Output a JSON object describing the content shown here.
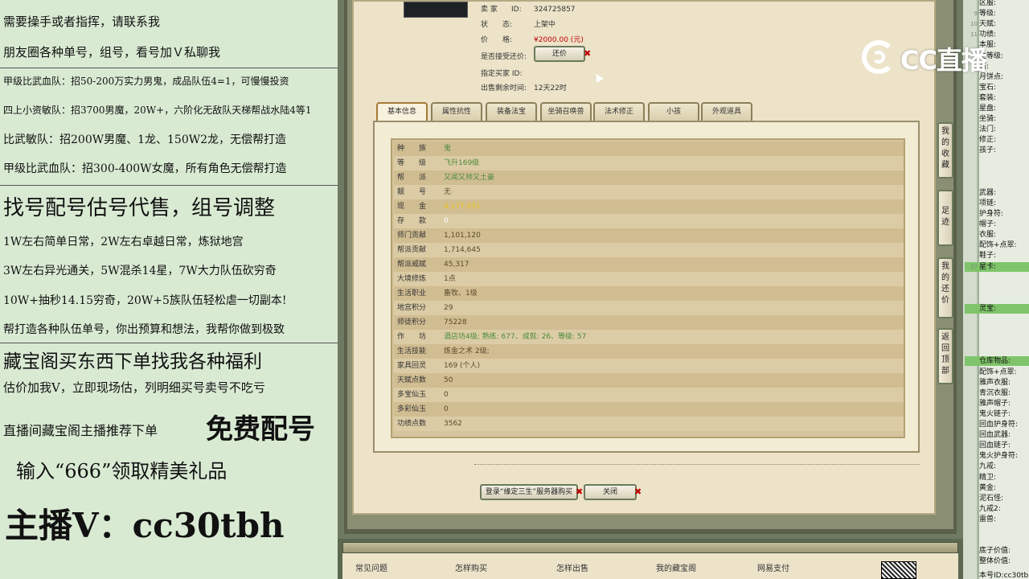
{
  "promo": {
    "lines": [
      "需要操手或者指挥，请联系我",
      "朋友圈各种单号，组号，看号加Ｖ私聊我",
      "甲级比武血队：招50-200万实力男鬼，成品队伍4=1，可慢慢投资",
      "四上小资敏队：招3700男魔，20W+，六阶化无敌队天梯帮战水陆4等1",
      "比武敏队：招200W男魔、1龙、150W2龙，无偿帮打造",
      "甲级比武血队：招300-400W女魔，所有角色无偿帮打造",
      "找号配号估号代售，组号调整",
      "1W左右简单日常，2W左右卓越日常，炼狱地宫",
      "3W左右异光通关，5W混杀14星，7W大力队伍砍穷奇",
      "10W+抽秒14.15穷奇，20W+5族队伍轻松虐一切副本!",
      "帮打造各种队伍单号，你出预算和想法，我帮你做到极致",
      "藏宝阁买东西下单找我各种福利",
      "估价加我V，立即现场估，列明细买号卖号不吃亏",
      "直播间藏宝阁主播推荐下单",
      "免费配号",
      "输入“666”领取精美礼品",
      "主播V：cc30tbh"
    ]
  },
  "listing": {
    "seller_label": "卖 家",
    "seller_id_key": "ID:",
    "seller_id": "324725857",
    "status_label": "状　　态:",
    "status": "上架中",
    "price_label": "价　　格:",
    "price": "¥2000.00 (元)",
    "bargain_label": "是否接受还价:",
    "bargain_button": "还价",
    "buyer_label": "指定买家 ID:",
    "time_label": "出售剩余时间:",
    "time_left": "12天22时"
  },
  "tabs": [
    {
      "label": "基本信息",
      "active": true
    },
    {
      "label": "属性抗性",
      "active": false
    },
    {
      "label": "装备法宝",
      "active": false
    },
    {
      "label": "坐骑召唤兽",
      "active": false
    },
    {
      "label": "法术修正",
      "active": false
    },
    {
      "label": "小孩",
      "active": false
    },
    {
      "label": "外观道具",
      "active": false
    }
  ],
  "info_table": [
    {
      "label": "种　　族",
      "value": "鬼",
      "style": "green"
    },
    {
      "label": "等　　级",
      "value": "飞升169级",
      "style": "green"
    },
    {
      "label": "帮　　派",
      "value": "又闻又帅又土豪",
      "style": "green"
    },
    {
      "label": "靓　　号",
      "value": "无",
      "style": "normal"
    },
    {
      "label": "现　　金",
      "value": "4,177,651",
      "style": "gold"
    },
    {
      "label": "存　　款",
      "value": "0",
      "style": "white"
    },
    {
      "label": "师门贡献",
      "value": "1,101,120",
      "style": "normal"
    },
    {
      "label": "帮派贡献",
      "value": "1,714,645",
      "style": "normal"
    },
    {
      "label": "帮派威赋",
      "value": "45,317",
      "style": "normal"
    },
    {
      "label": "大境修炼",
      "value": "1点",
      "style": "normal"
    },
    {
      "label": "生活职业",
      "value": "畜牧、1级",
      "style": "normal"
    },
    {
      "label": "地宫积分",
      "value": "29",
      "style": "normal"
    },
    {
      "label": "师徒积分",
      "value": "75228",
      "style": "normal"
    },
    {
      "label": "作　　坊",
      "value": "酒店坊4级; 熟练: 677、成就: 26、等级: 57",
      "style": "green"
    },
    {
      "label": "生活技能",
      "value": "炼金之术 2级;",
      "style": "normal"
    },
    {
      "label": "家具回灵",
      "value": "169 (个人)",
      "style": "normal"
    },
    {
      "label": "天赋点数",
      "value": "50",
      "style": "normal"
    },
    {
      "label": "多宝仙玉",
      "value": "0",
      "style": "normal"
    },
    {
      "label": "多彩仙玉",
      "value": "0",
      "style": "normal"
    },
    {
      "label": "功绩点数",
      "value": "3562",
      "style": "normal"
    }
  ],
  "actions": {
    "login_buy": "登录“缘定三生”服务器购买",
    "close": "关闭"
  },
  "side_buttons": [
    "我的收藏",
    "足迹",
    "我的还价",
    "返回顶部"
  ],
  "footer_links": [
    "常见问题",
    "怎样购买",
    "怎样出售",
    "我的藏宝阁",
    "网易支付"
  ],
  "right_panel": {
    "lines": [
      {
        "n": "",
        "t": "区服:"
      },
      {
        "n": "9",
        "t": "等级:"
      },
      {
        "n": "10",
        "t": "天赋:"
      },
      {
        "n": "11",
        "t": "功绩:"
      },
      {
        "n": "",
        "t": "本服:"
      },
      {
        "n": "",
        "t": "生等级:"
      },
      {
        "n": "",
        "t": "石:"
      },
      {
        "n": "",
        "t": "月饼点:"
      },
      {
        "n": "",
        "t": "宝石:"
      },
      {
        "n": "",
        "t": "套装:"
      },
      {
        "n": "",
        "t": "星盘:"
      },
      {
        "n": "",
        "t": "坐骑:"
      },
      {
        "n": "",
        "t": "法门:"
      },
      {
        "n": "",
        "t": "修正:"
      },
      {
        "n": "",
        "t": "孩子:"
      },
      {
        "n": "",
        "t": ""
      },
      {
        "n": "",
        "t": ""
      },
      {
        "n": "",
        "t": ""
      },
      {
        "n": "",
        "t": "武器:"
      },
      {
        "n": "",
        "t": "项链:"
      },
      {
        "n": "",
        "t": "护身符:"
      },
      {
        "n": "",
        "t": "帽子:"
      },
      {
        "n": "",
        "t": "衣服:"
      },
      {
        "n": "",
        "t": "配饰+点翠:"
      },
      {
        "n": "",
        "t": "鞋子:"
      },
      {
        "n": "27",
        "t": "星卡:"
      },
      {
        "n": "",
        "t": ""
      },
      {
        "n": "",
        "t": ""
      },
      {
        "n": "",
        "t": ""
      },
      {
        "n": "",
        "t": "灵宝:"
      },
      {
        "n": "",
        "t": ""
      },
      {
        "n": "",
        "t": ""
      },
      {
        "n": "",
        "t": ""
      },
      {
        "n": "",
        "t": ""
      },
      {
        "n": "",
        "t": "仓库物品:"
      },
      {
        "n": "",
        "t": "配饰+点翠:"
      },
      {
        "n": "",
        "t": "雅声衣服:"
      },
      {
        "n": "",
        "t": "青沉衣服:"
      },
      {
        "n": "",
        "t": "雅声帽子:"
      },
      {
        "n": "",
        "t": "鬼火链子:"
      },
      {
        "n": "",
        "t": "回血护身符:"
      },
      {
        "n": "",
        "t": "回血武器:"
      },
      {
        "n": "",
        "t": "回血链子:"
      },
      {
        "n": "",
        "t": "鬼火护身符:"
      },
      {
        "n": "",
        "t": "九戒:"
      },
      {
        "n": "",
        "t": "精卫:"
      },
      {
        "n": "",
        "t": "黄金:"
      },
      {
        "n": "",
        "t": "泥石怪:"
      },
      {
        "n": "",
        "t": "九戒2:"
      },
      {
        "n": "",
        "t": "雷兽:"
      },
      {
        "n": "",
        "t": ""
      },
      {
        "n": "",
        "t": ""
      },
      {
        "n": "",
        "t": "底子价值:"
      },
      {
        "n": "",
        "t": "整体价值:"
      }
    ],
    "bottom": "本号ID:cc30tbh"
  },
  "logo": {
    "text": "CC直播"
  },
  "colors": {
    "accent_green": "#7fc46a",
    "price_red": "#c00000",
    "panel_bg": "#d9ead3"
  }
}
